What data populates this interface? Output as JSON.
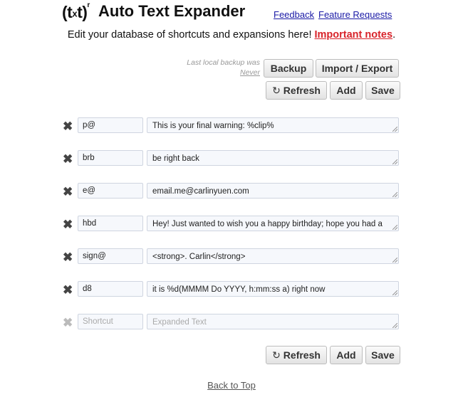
{
  "header": {
    "logo_text_open": "(t",
    "logo_text_x": "x",
    "logo_text_close": "t)",
    "logo_sup": "r",
    "title": "Auto Text Expander",
    "links": {
      "feedback": "Feedback",
      "feature_requests": "Feature Requests"
    }
  },
  "subtitle": {
    "text": "Edit your database of shortcuts and expansions here! ",
    "important_link": "Important notes",
    "period": "."
  },
  "backup": {
    "note_line1": "Last local backup was",
    "note_line2": "Never"
  },
  "toolbar": {
    "backup_label": "Backup",
    "import_export_label": "Import / Export",
    "refresh_label": "Refresh",
    "add_label": "Add",
    "save_label": "Save",
    "refresh_icon": "refresh-icon"
  },
  "rows": [
    {
      "shortcut": "p@",
      "expansion": "This is your final warning: %clip%"
    },
    {
      "shortcut": "brb",
      "expansion": "be right back"
    },
    {
      "shortcut": "e@",
      "expansion": "email.me@carlinyuen.com"
    },
    {
      "shortcut": "hbd",
      "expansion": "Hey! Just wanted to wish you a happy birthday; hope you had a"
    },
    {
      "shortcut": "sign@",
      "expansion": "<strong>. Carlin</strong>"
    },
    {
      "shortcut": "d8",
      "expansion": "it is %d(MMMM Do YYYY, h:mm:ss a) right now"
    }
  ],
  "new_row": {
    "shortcut_placeholder": "Shortcut",
    "expansion_placeholder": "Expanded Text"
  },
  "delete_glyph": "✖",
  "footer": {
    "back_to_top": "Back to Top"
  }
}
